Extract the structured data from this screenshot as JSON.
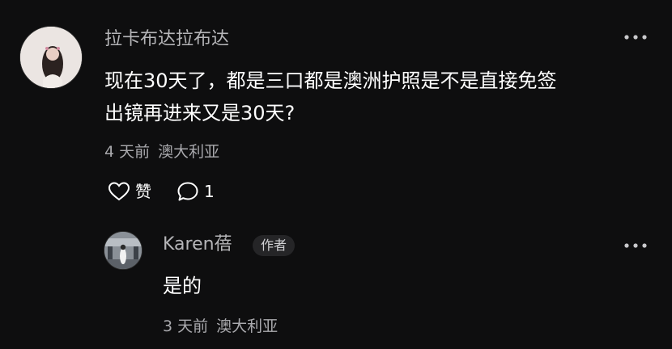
{
  "colors": {
    "background": "#0e0e0f",
    "text_primary": "#ffffff",
    "text_secondary": "#a9a9ad",
    "badge_bg": "#252527"
  },
  "comment": {
    "author": "拉卡布达拉布达",
    "text_line1": "现在30天了，都是三口都是澳洲护照是不是直接免签",
    "text_line2": "出镜再进来又是30天?",
    "time": "4 天前",
    "location": "澳大利亚",
    "like_label": "赞",
    "reply_count": "1",
    "more_icon": "more-horizontal-icon"
  },
  "reply": {
    "author": "Karen蓓",
    "author_badge": "作者",
    "text": "是的",
    "time": "3 天前",
    "location": "澳大利亚",
    "more_icon": "more-horizontal-icon"
  }
}
